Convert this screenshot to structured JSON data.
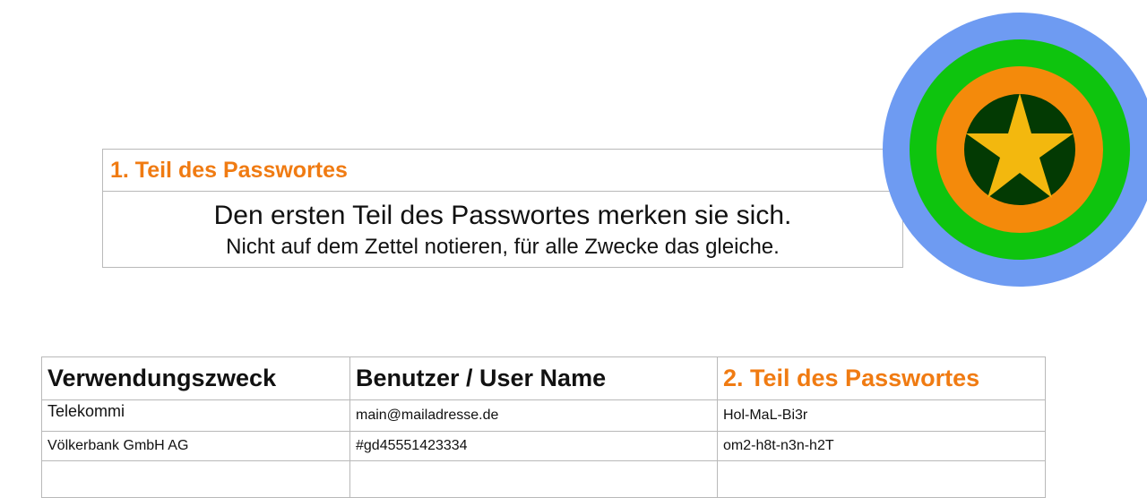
{
  "part1": {
    "heading": "1. Teil des Passwortes",
    "line1": "Den ersten Teil des Passwortes merken sie sich.",
    "line2": "Nicht auf dem Zettel notieren, für alle Zwecke das gleiche."
  },
  "target_graphic": {
    "rings": [
      "#6e9bf2",
      "#0ec40e",
      "#f48a0b",
      "#033a03"
    ],
    "star_color": "#f3b80e",
    "icon": "star-target-icon"
  },
  "table": {
    "headers": [
      "Verwendungszweck",
      "Benutzer / User Name",
      "2. Teil des Passwortes"
    ],
    "rows": [
      [
        "Telekommi",
        "main@mailadresse.de",
        "Hol-MaL-Bi3r"
      ],
      [
        "Völkerbank GmbH AG",
        "#gd45551423334",
        "om2-h8t-n3n-h2T"
      ],
      [
        "",
        "",
        ""
      ]
    ]
  }
}
